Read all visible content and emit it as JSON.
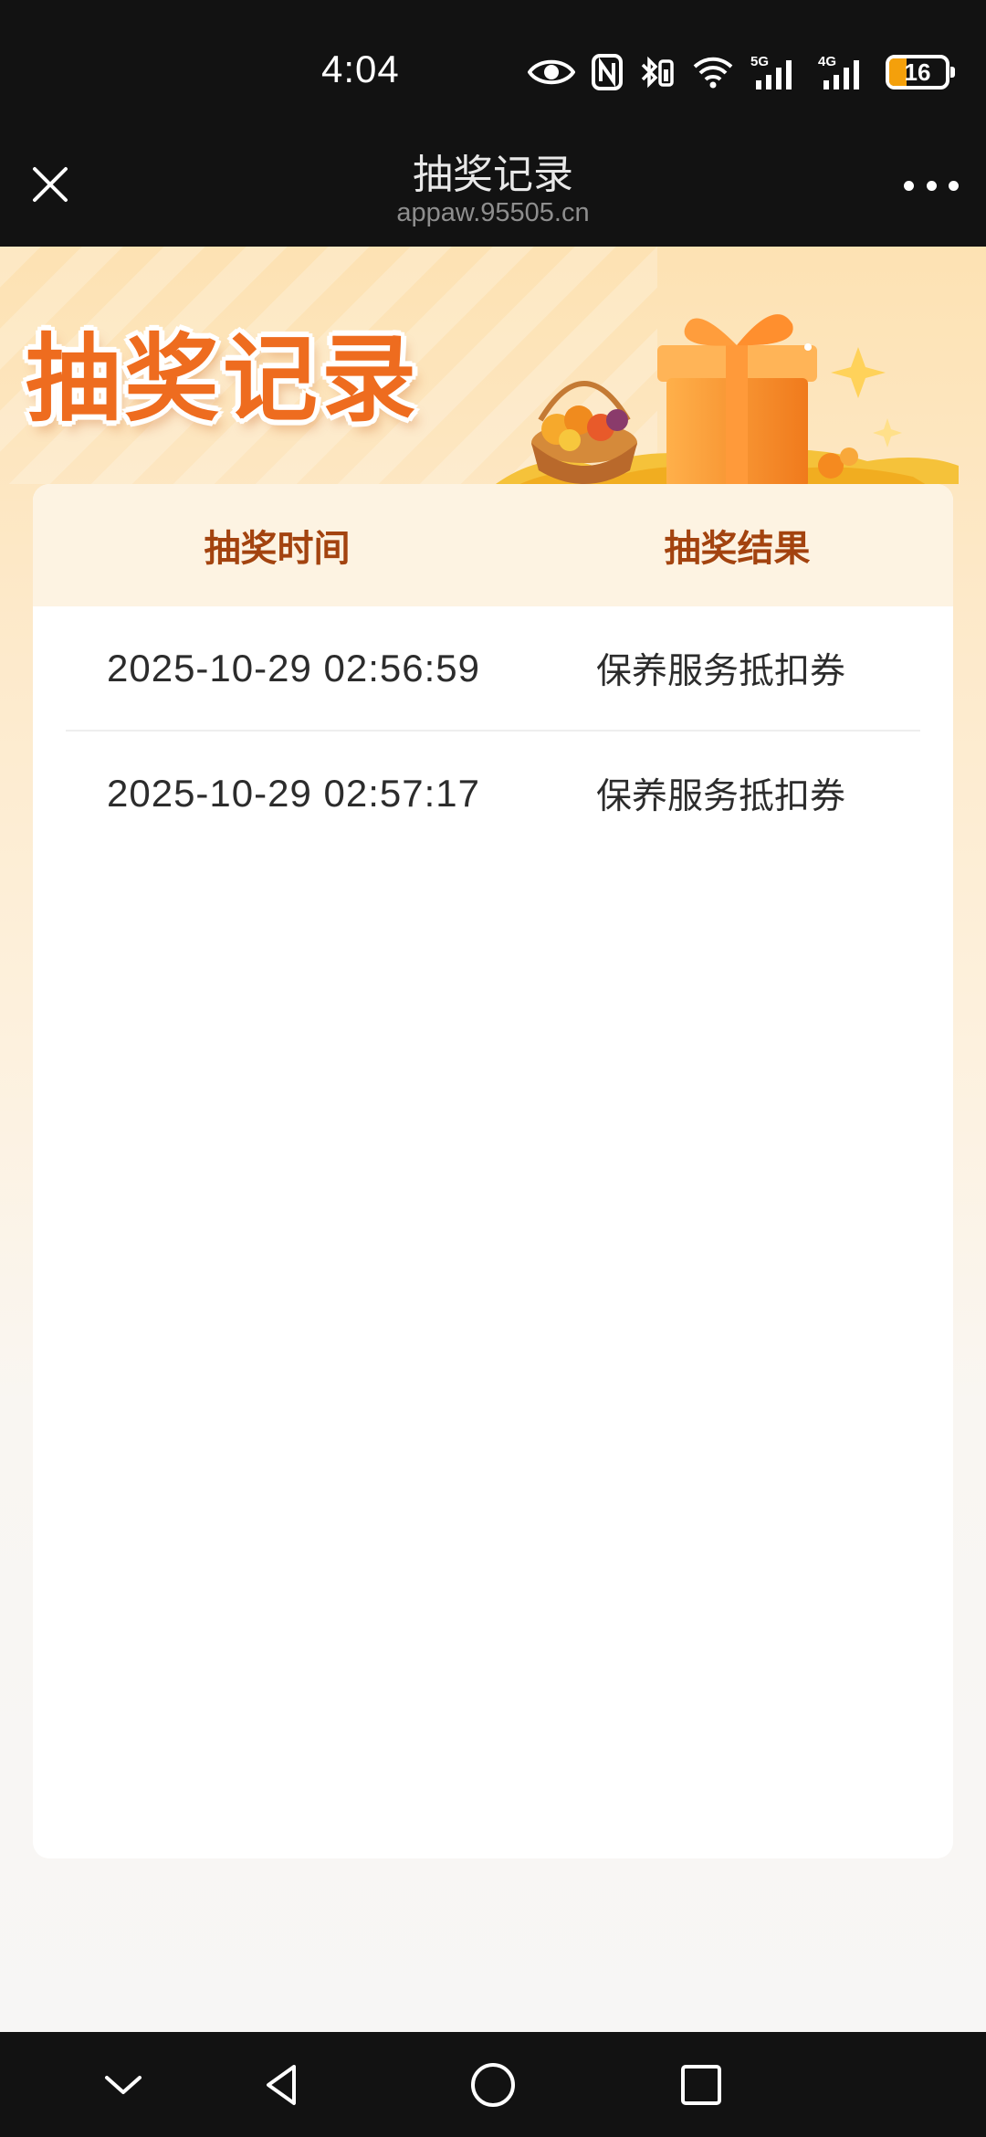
{
  "status_bar": {
    "time": "4:04",
    "icons": [
      "eye-icon",
      "nfc-icon",
      "bluetooth-icon",
      "wifi-icon",
      "signal-5g-icon",
      "signal-4g-icon"
    ],
    "network_1": "5G",
    "network_2": "4G",
    "battery_level": "16",
    "battery_color": "#f4a00b"
  },
  "title_bar": {
    "title": "抽奖记录",
    "url": "appaw.95505.cn"
  },
  "banner": {
    "title": "抽奖记录"
  },
  "table": {
    "headers": {
      "time": "抽奖时间",
      "result": "抽奖结果"
    },
    "rows": [
      {
        "time": "2025-10-29 02:56:59",
        "result": "保养服务抵扣券"
      },
      {
        "time": "2025-10-29 02:57:17",
        "result": "保养服务抵扣券"
      }
    ]
  },
  "colors": {
    "accent": "#ee6c1f",
    "header_text": "#a3430f",
    "header_bg": "#fdf3e2"
  }
}
